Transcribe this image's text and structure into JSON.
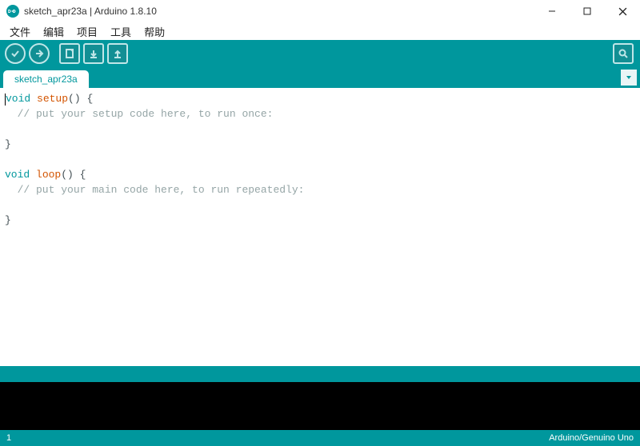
{
  "window": {
    "title": "sketch_apr23a | Arduino 1.8.10"
  },
  "menu": {
    "file": "文件",
    "edit": "编辑",
    "sketch": "项目",
    "tools": "工具",
    "help": "帮助"
  },
  "tab": {
    "name": "sketch_apr23a"
  },
  "code": {
    "kw_void1": "void",
    "fn_setup": "setup",
    "paren1": "() {",
    "comment_setup": "  // put your setup code here, to run once:",
    "blank1": "",
    "close1": "}",
    "blank2": "",
    "kw_void2": "void",
    "fn_loop": "loop",
    "paren2": "() {",
    "comment_loop": "  // put your main code here, to run repeatedly:",
    "blank3": "",
    "close2": "}"
  },
  "status": {
    "line": "1",
    "board": "Arduino/Genuino Uno"
  }
}
